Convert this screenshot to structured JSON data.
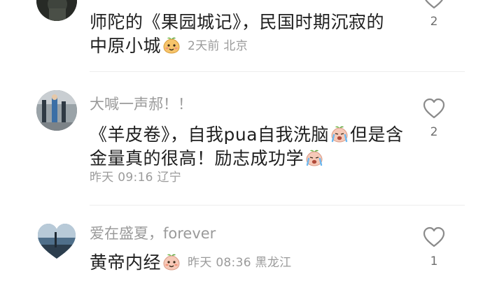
{
  "comments": [
    {
      "text_lines": [
        "师陀的《果园城记》，民国时期沉寂的",
        "中原小城"
      ],
      "meta": "2天前 北京",
      "likes": "2"
    },
    {
      "username": "大喊一声郝！！",
      "text_line1_prefix": "《羊皮卷》，自我pua自我洗脑",
      "text_line1_suffix": "但是含",
      "text_line2": "金量真的很高！励志成功学",
      "meta": "昨天 09:16 辽宁",
      "likes": "2"
    },
    {
      "username": "爱在盛夏，forever",
      "text_line": "黄帝内经",
      "meta": "昨天 08:36 黑龙江",
      "likes": "1"
    }
  ],
  "icons": {
    "like": "heart-outline-icon",
    "emoji_a": "peach-face-emoji-icon",
    "emoji_b": "crying-face-emoji-icon"
  },
  "colors": {
    "text": "#1f1f1f",
    "username": "#9a9a9a",
    "meta": "#9b9b9b",
    "divider": "#ededed"
  }
}
